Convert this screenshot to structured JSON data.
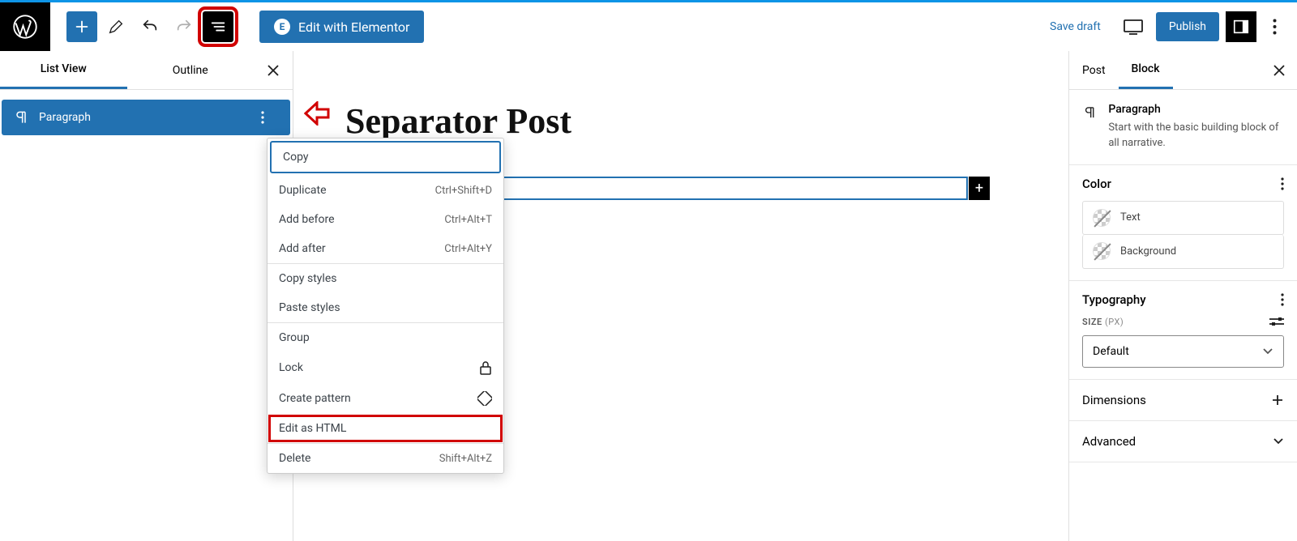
{
  "toolbar": {
    "elementor_label": "Edit with Elementor",
    "save_draft": "Save draft",
    "publish": "Publish"
  },
  "left_panel": {
    "tabs": {
      "list_view": "List View",
      "outline": "Outline"
    },
    "row_label": "Paragraph"
  },
  "content": {
    "title": "Separator Post"
  },
  "context_menu": {
    "copy": "Copy",
    "duplicate": "Duplicate",
    "duplicate_short": "Ctrl+Shift+D",
    "add_before": "Add before",
    "add_before_short": "Ctrl+Alt+T",
    "add_after": "Add after",
    "add_after_short": "Ctrl+Alt+Y",
    "copy_styles": "Copy styles",
    "paste_styles": "Paste styles",
    "group": "Group",
    "lock": "Lock",
    "create_pattern": "Create pattern",
    "edit_html": "Edit as HTML",
    "delete": "Delete",
    "delete_short": "Shift+Alt+Z"
  },
  "right_panel": {
    "tabs": {
      "post": "Post",
      "block": "Block"
    },
    "block_name": "Paragraph",
    "block_desc": "Start with the basic building block of all narrative.",
    "color_header": "Color",
    "color_text": "Text",
    "color_bg": "Background",
    "typography_header": "Typography",
    "size_label": "SIZE",
    "size_unit": "(PX)",
    "size_value": "Default",
    "dimensions": "Dimensions",
    "advanced": "Advanced"
  }
}
